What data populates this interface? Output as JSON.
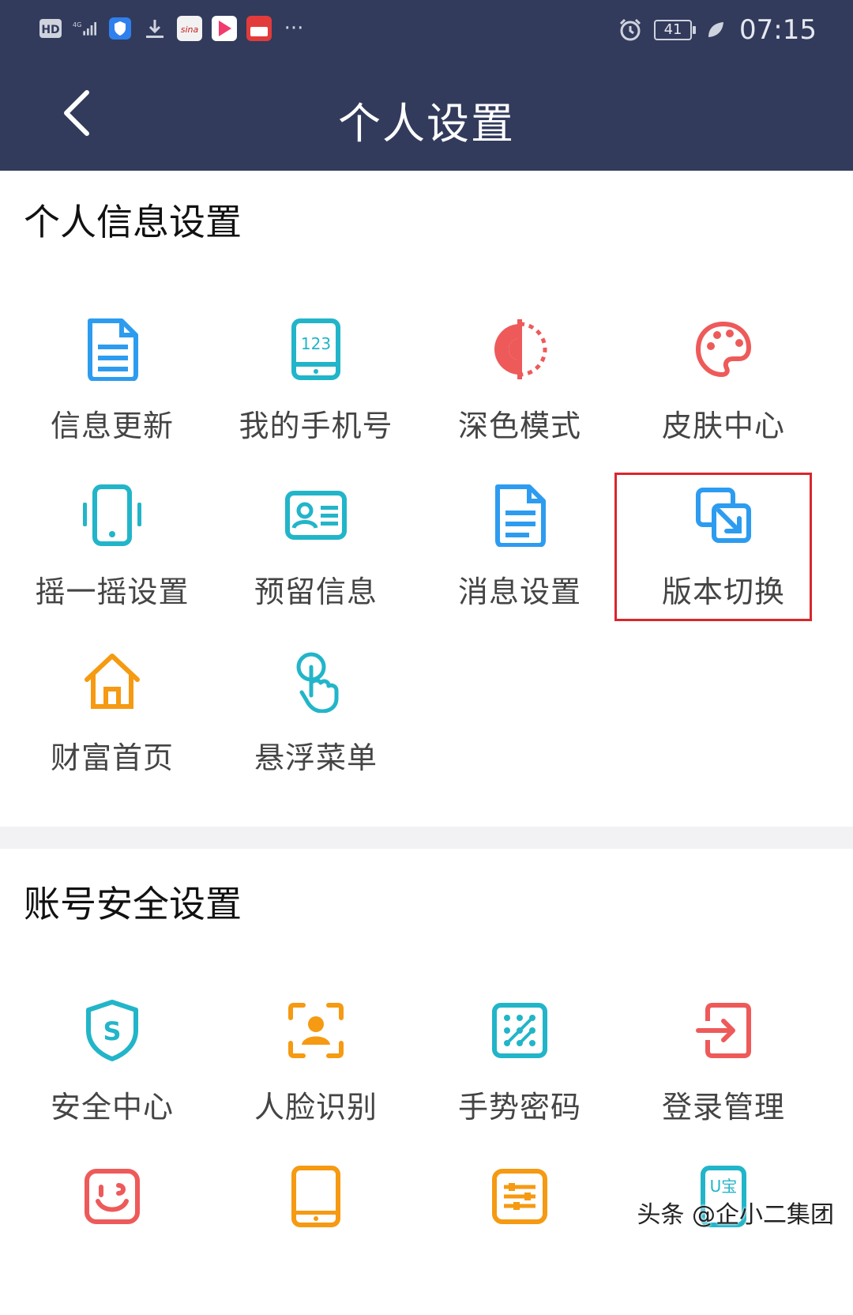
{
  "status_bar": {
    "left_icons": [
      "hd-icon",
      "signal-4g-icon",
      "shield-app-icon",
      "download-icon",
      "sina-app-icon",
      "video-app-icon",
      "pay-app-icon",
      "more-dots-icon"
    ],
    "sina_text": "sina",
    "network_text": "4G",
    "hd_text": "HD",
    "more_text": "···",
    "battery": "41",
    "time": "07:15"
  },
  "header": {
    "title": "个人设置",
    "bg_color": "#323b5c"
  },
  "sections": [
    {
      "title": "个人信息设置",
      "items": [
        {
          "label": "信息更新",
          "icon": "document-icon",
          "color": "#2d9cf0"
        },
        {
          "label": "我的手机号",
          "icon": "phone-123-icon",
          "color": "#22b5c9"
        },
        {
          "label": "深色模式",
          "icon": "dark-mode-icon",
          "color": "#ee5a5a"
        },
        {
          "label": "皮肤中心",
          "icon": "palette-icon",
          "color": "#ee5a5a"
        },
        {
          "label": "摇一摇设置",
          "icon": "shake-phone-icon",
          "color": "#22b5c9"
        },
        {
          "label": "预留信息",
          "icon": "id-card-icon",
          "color": "#22b5c9"
        },
        {
          "label": "消息设置",
          "icon": "message-doc-icon",
          "color": "#2d9cf0"
        },
        {
          "label": "版本切换",
          "icon": "switch-version-icon",
          "color": "#2d9cf0"
        },
        {
          "label": "财富首页",
          "icon": "home-icon",
          "color": "#f59a12"
        },
        {
          "label": "悬浮菜单",
          "icon": "touch-hand-icon",
          "color": "#22b5c9"
        }
      ]
    },
    {
      "title": "账号安全设置",
      "items": [
        {
          "label": "安全中心",
          "icon": "shield-s-icon",
          "color": "#22b5c9"
        },
        {
          "label": "人脸识别",
          "icon": "face-scan-icon",
          "color": "#f59a12"
        },
        {
          "label": "手势密码",
          "icon": "gesture-pattern-icon",
          "color": "#22b5c9"
        },
        {
          "label": "登录管理",
          "icon": "login-icon",
          "color": "#ee5a5a"
        },
        {
          "label": "",
          "icon": "smile-card-icon",
          "color": "#ee5a5a"
        },
        {
          "label": "",
          "icon": "tablet-icon",
          "color": "#f59a12"
        },
        {
          "label": "",
          "icon": "sliders-icon",
          "color": "#f59a12"
        },
        {
          "label": "",
          "icon": "ukey-icon",
          "color": "#22b5c9",
          "icon_text": "U宝"
        }
      ]
    }
  ],
  "watermark": "头条 @企小二集团",
  "highlight_color": "#d9262c"
}
